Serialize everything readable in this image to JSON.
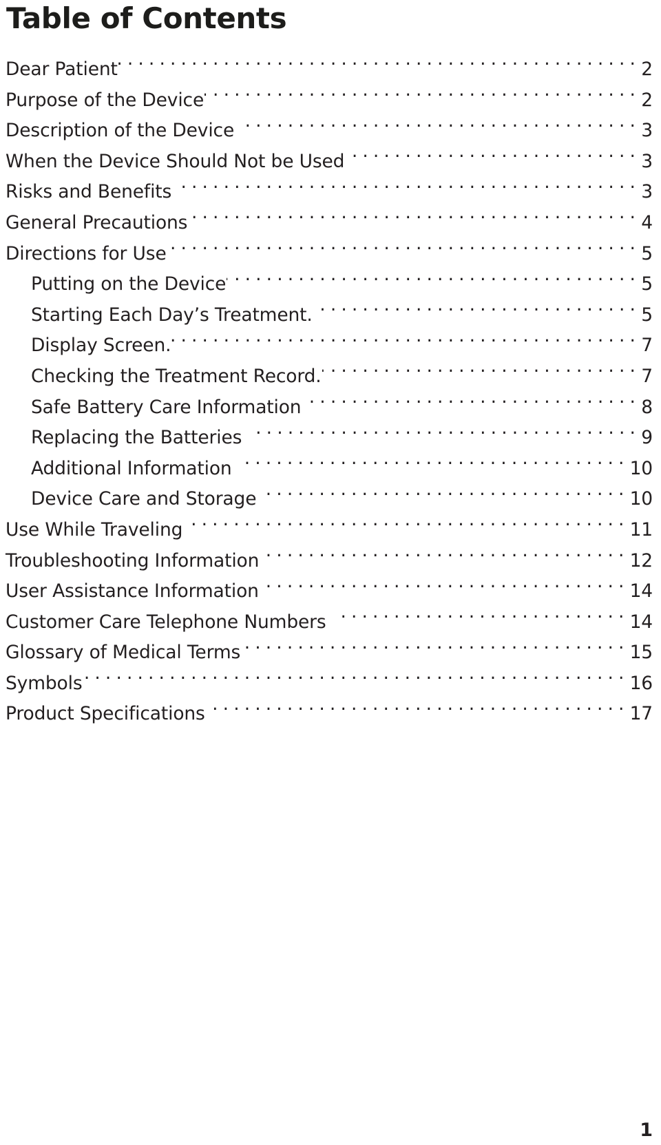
{
  "document": {
    "title": "Table of Contents",
    "footer_page_number": "1",
    "text_color": "#231f20",
    "title_color": "#1d1d1b",
    "background_color": "#ffffff"
  },
  "toc": {
    "entries": [
      {
        "label": "Dear Patient",
        "page": "2",
        "level": 1,
        "gap": false
      },
      {
        "label": "Purpose of the Device",
        "page": "2",
        "level": 1,
        "gap": false
      },
      {
        "label": "Description of the Device",
        "page": "3",
        "level": 1,
        "gap": true
      },
      {
        "label": "When the Device Should Not be Used",
        "page": "3",
        "level": 1,
        "gap": false
      },
      {
        "label": "Risks and Benefits",
        "page": "3",
        "level": 1,
        "gap": true
      },
      {
        "label": "General Precautions",
        "page": "4",
        "level": 1,
        "gap": false
      },
      {
        "label": "Directions for Use",
        "page": "5",
        "level": 1,
        "gap": false
      },
      {
        "label": "Putting on the Device",
        "page": "5",
        "level": 2,
        "gap": false
      },
      {
        "label": "Starting Each Day’s Treatment.",
        "page": "5",
        "level": 2,
        "gap": false
      },
      {
        "label": "Display Screen.",
        "page": "7",
        "level": 2,
        "gap": false
      },
      {
        "label": "Checking the Treatment Record.",
        "page": "7",
        "level": 2,
        "gap": false
      },
      {
        "label": "Safe Battery Care Information",
        "page": "8",
        "level": 2,
        "gap": true
      },
      {
        "label": "Replacing the Batteries",
        "page": "9",
        "level": 2,
        "gap": true
      },
      {
        "label": "Additional Information",
        "page": "10",
        "level": 2,
        "gap": true
      },
      {
        "label": "Device Care and Storage",
        "page": "10",
        "level": 2,
        "gap": true
      },
      {
        "label": "Use While Traveling",
        "page": "11",
        "level": 1,
        "gap": true
      },
      {
        "label": "Troubleshooting Information",
        "page": "12",
        "level": 1,
        "gap": false
      },
      {
        "label": "User Assistance Information",
        "page": "14",
        "level": 1,
        "gap": true
      },
      {
        "label": "Customer Care Telephone Numbers",
        "page": "14",
        "level": 1,
        "gap": true
      },
      {
        "label": "Glossary of Medical Terms",
        "page": "15",
        "level": 1,
        "gap": false
      },
      {
        "label": "Symbols",
        "page": "16",
        "level": 1,
        "gap": false
      },
      {
        "label": "Product Specifications",
        "page": "17",
        "level": 1,
        "gap": true
      }
    ]
  }
}
